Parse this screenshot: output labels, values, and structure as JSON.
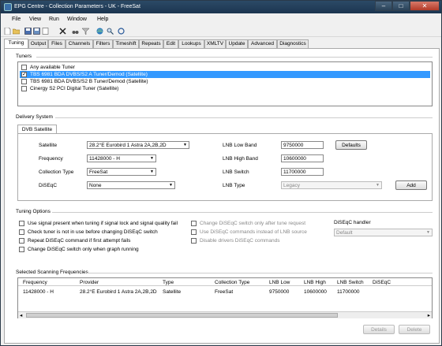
{
  "window": {
    "title": "EPG Centre - Collection Parameters - UK - FreeSat"
  },
  "menu": {
    "file": "File",
    "view": "View",
    "run": "Run",
    "window": "Window",
    "help": "Help"
  },
  "tabs": [
    "Tuning",
    "Output",
    "Files",
    "Channels",
    "Filters",
    "Timeshift",
    "Repeats",
    "Edit",
    "Lookups",
    "XMLTV",
    "Update",
    "Advanced",
    "Diagnostics"
  ],
  "tuners": {
    "label": "Tuners",
    "items": [
      {
        "label": "Any available Tuner",
        "checked": false,
        "selected": false
      },
      {
        "label": "TBS 6981 BDA DVBS/S2 A Tuner/Demod (Satellite)",
        "checked": true,
        "selected": true
      },
      {
        "label": "TBS 6981 BDA DVBS/S2 B Tuner/Demod (Satellite)",
        "checked": false,
        "selected": false
      },
      {
        "label": "Cinergy S2 PCI Digital Tuner (Satellite)",
        "checked": false,
        "selected": false
      }
    ]
  },
  "delivery": {
    "label": "Delivery System",
    "tab": "DVB Satellite",
    "satellite_label": "Satellite",
    "satellite_value": "28.2°E Eurobird 1   Astra 2A,2B,2D",
    "frequency_label": "Frequency",
    "frequency_value": "11428000 - H",
    "collection_label": "Collection Type",
    "collection_value": "FreeSat",
    "diseqc_label": "DiSEqC",
    "diseqc_value": "None",
    "lnb_low_label": "LNB Low Band",
    "lnb_low_value": "9750000",
    "lnb_high_label": "LNB High Band",
    "lnb_high_value": "10600000",
    "lnb_switch_label": "LNB Switch",
    "lnb_switch_value": "11700000",
    "lnb_type_label": "LNB Type",
    "lnb_type_value": "Legacy",
    "defaults_button": "Defaults",
    "add_button": "Add"
  },
  "tuning_options": {
    "label": "Tuning Options",
    "opt1": "Use signal present when tuning if signal lock and signal quality fail",
    "opt2": "Check tuner is not in use before changing DiSEqC switch",
    "opt3": "Repeat DiSEqC command if first attempt fails",
    "opt4": "Change DiSEqC switch only when graph running",
    "opt5": "Change DiSEqC switch only after tune request",
    "opt6": "Use DiSEqC commands instead of LNB source",
    "opt7": "Disable drivers DiSEqC commands",
    "handler_label": "DiSEqC handler",
    "handler_value": "Default"
  },
  "scanning": {
    "label": "Selected Scanning Frequencies",
    "columns": [
      "Frequency",
      "Provider",
      "Type",
      "Collection Type",
      "LNB Low",
      "LNB High",
      "LNB Switch",
      "DiSEqC"
    ],
    "rows": [
      [
        "11428000 - H",
        "28.2°E Eurobird 1   Astra 2A,2B,2D",
        "Satellite",
        "FreeSat",
        "9750000",
        "10600000",
        "11700000",
        ""
      ]
    ],
    "details_button": "Details",
    "delete_button": "Delete"
  },
  "window_buttons": {
    "minimize": "–",
    "maximize": "□",
    "close": "✕"
  },
  "colors": {
    "selection": "#3399ff",
    "titlebar": "#2b4a66"
  }
}
